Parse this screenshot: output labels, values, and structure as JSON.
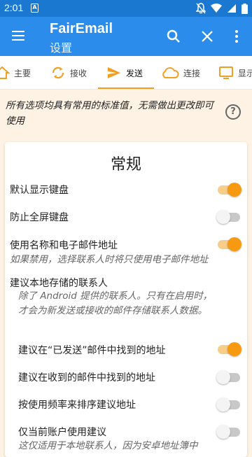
{
  "status_bar": {
    "time": "2:01",
    "notification_letter": "A"
  },
  "app_bar": {
    "title": "FairEmail",
    "subtitle": "设置"
  },
  "tabs": [
    {
      "label": "主要",
      "icon": "home-icon"
    },
    {
      "label": "接收",
      "icon": "sync-icon"
    },
    {
      "label": "发送",
      "icon": "send-icon",
      "active": true
    },
    {
      "label": "连接",
      "icon": "cloud-icon"
    },
    {
      "label": "显示",
      "icon": "monitor-icon"
    }
  ],
  "intro": "所有选项均具有常用的标准值，无需做出更改即可使用",
  "section": {
    "title": "常规",
    "rows": [
      {
        "label": "默认显示键盘",
        "on": true
      },
      {
        "label": "防止全屏键盘",
        "on": false
      },
      {
        "label": "使用名称和电子邮件地址",
        "on": true,
        "hint": "如果禁用，选择联系人时将只使用电子邮件地址"
      },
      {
        "label": "建议本地存储的联系人",
        "hint": "除了 Android 提供的联系人。只有在启用时，才会为新发送或接收的邮件存储联系人数据。"
      },
      {
        "label": "建议在“已发送”邮件中找到的地址",
        "on": true
      },
      {
        "label": "建议在收到的邮件中找到的地址",
        "on": false
      },
      {
        "label": "按使用频率来排序建议地址",
        "on": false
      },
      {
        "label": "仅当前账户使用建议",
        "on": false,
        "hint": "这仅适用于本地联系人，因为安卓地址簿中"
      }
    ]
  },
  "colors": {
    "primary": "#2b8ceb",
    "status": "#1a78d0",
    "accent": "#f79a12"
  }
}
